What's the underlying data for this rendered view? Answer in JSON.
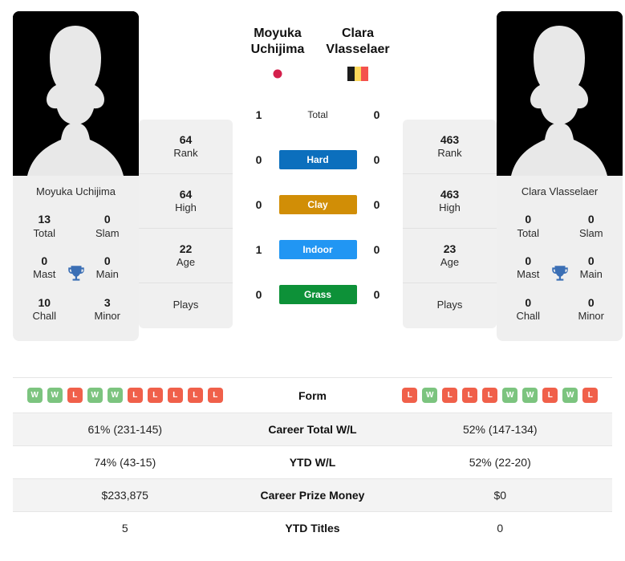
{
  "players": {
    "left": {
      "first_name": "Moyuka",
      "last_name": "Uchijima",
      "full_name": "Moyuka Uchijima",
      "flag": "japan-flag",
      "photo": "player-silhouette-photo",
      "titles": {
        "total_num": "13",
        "total_label": "Total",
        "slam_num": "0",
        "slam_label": "Slam",
        "mast_num": "0",
        "mast_label": "Mast",
        "main_num": "0",
        "main_label": "Main",
        "chall_num": "10",
        "chall_label": "Chall",
        "minor_num": "3",
        "minor_label": "Minor"
      },
      "ranks": {
        "rank_num": "64",
        "rank_label": "Rank",
        "high_num": "64",
        "high_label": "High",
        "age_num": "22",
        "age_label": "Age",
        "plays_num": "",
        "plays_label": "Plays"
      },
      "h2h": {
        "total": "1",
        "hard": "0",
        "clay": "0",
        "indoor": "1",
        "grass": "0"
      },
      "form": [
        "W",
        "W",
        "L",
        "W",
        "W",
        "L",
        "L",
        "L",
        "L",
        "L"
      ],
      "career_total_wl": "61% (231-145)",
      "ytd_wl": "74% (43-15)",
      "career_prize_money": "$233,875",
      "ytd_titles": "5"
    },
    "right": {
      "first_name": "Clara",
      "last_name": "Vlasselaer",
      "full_name": "Clara Vlasselaer",
      "flag": "belgium-flag",
      "photo": "player-silhouette-photo",
      "titles": {
        "total_num": "0",
        "total_label": "Total",
        "slam_num": "0",
        "slam_label": "Slam",
        "mast_num": "0",
        "mast_label": "Mast",
        "main_num": "0",
        "main_label": "Main",
        "chall_num": "0",
        "chall_label": "Chall",
        "minor_num": "0",
        "minor_label": "Minor"
      },
      "ranks": {
        "rank_num": "463",
        "rank_label": "Rank",
        "high_num": "463",
        "high_label": "High",
        "age_num": "23",
        "age_label": "Age",
        "plays_num": "",
        "plays_label": "Plays"
      },
      "h2h": {
        "total": "0",
        "hard": "0",
        "clay": "0",
        "indoor": "0",
        "grass": "0"
      },
      "form": [
        "L",
        "W",
        "L",
        "L",
        "L",
        "W",
        "W",
        "L",
        "W",
        "L"
      ],
      "career_total_wl": "52% (147-134)",
      "ytd_wl": "52% (22-20)",
      "career_prize_money": "$0",
      "ytd_titles": "0"
    }
  },
  "surface_labels": {
    "total": "Total",
    "hard": "Hard",
    "clay": "Clay",
    "indoor": "Indoor",
    "grass": "Grass"
  },
  "table_labels": {
    "form": "Form",
    "career_total_wl": "Career Total W/L",
    "ytd_wl": "YTD W/L",
    "career_prize_money": "Career Prize Money",
    "ytd_titles": "YTD Titles"
  },
  "colors": {
    "hard": "#0c6fbd",
    "clay": "#d18e06",
    "indoor": "#2196f3",
    "grass": "#0d9138",
    "win_badge": "#7cc47f",
    "loss_badge": "#f0604a",
    "trophy": "#3b6fb5",
    "japan_red": "#d4204c",
    "belgium_black": "#1b1b1b",
    "belgium_yellow": "#fbd75b",
    "belgium_red": "#f4524d",
    "card_bg": "#efefef",
    "row_alt_bg": "#f3f3f3"
  }
}
